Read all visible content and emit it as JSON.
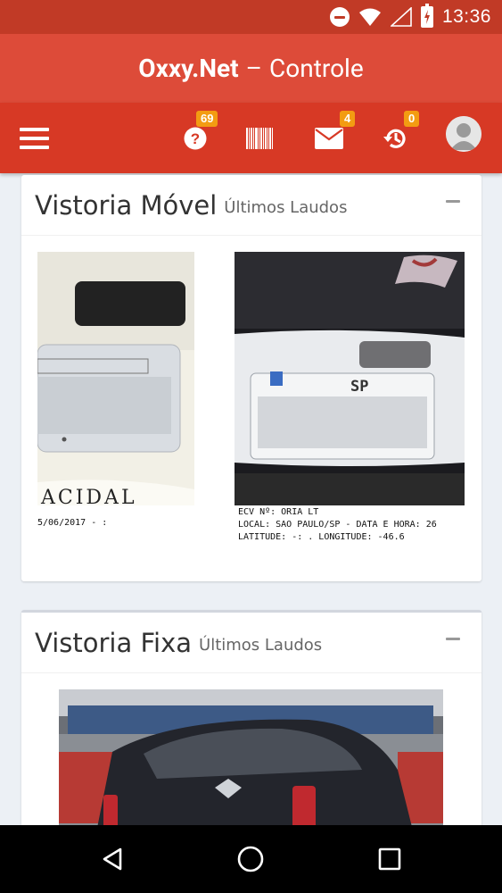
{
  "status_bar": {
    "time": "13:36",
    "icons": [
      "do-not-disturb-icon",
      "wifi-icon",
      "signal-icon",
      "battery-charging-icon"
    ]
  },
  "app": {
    "brand": "Oxxy.Net",
    "separator": "–",
    "subtitle": "Controle"
  },
  "toolbar": {
    "items": [
      {
        "name": "menu-icon"
      },
      {
        "name": "help-icon",
        "badge": "69"
      },
      {
        "name": "barcode-icon"
      },
      {
        "name": "mail-icon",
        "badge": "4"
      },
      {
        "name": "history-icon",
        "badge": "0"
      },
      {
        "name": "avatar"
      }
    ]
  },
  "colors": {
    "status_bar": "#c13a26",
    "title_bar": "#dd4b39",
    "toolbar": "#d73925",
    "badge": "#f39c12",
    "background": "#ecf0f5"
  },
  "boxes": [
    {
      "title": "Vistoria Móvel",
      "subtitle": "Últimos Laudos",
      "images": [
        {
          "caption_lines": [
            "5/06/2017 - :"
          ]
        },
        {
          "caption_lines": [
            "ECV Nº:                ORIA LT",
            "LOCAL: SAO PAULO/SP - DATA E HORA: 26",
            "LATITUDE: -:           . LONGITUDE: -46.6"
          ]
        }
      ],
      "plate_text": "SP",
      "partial_text": "ACIDAL"
    },
    {
      "title": "Vistoria Fixa",
      "subtitle": "Últimos Laudos"
    }
  ],
  "nav": {
    "buttons": [
      "back-icon",
      "home-icon",
      "recents-icon"
    ]
  }
}
